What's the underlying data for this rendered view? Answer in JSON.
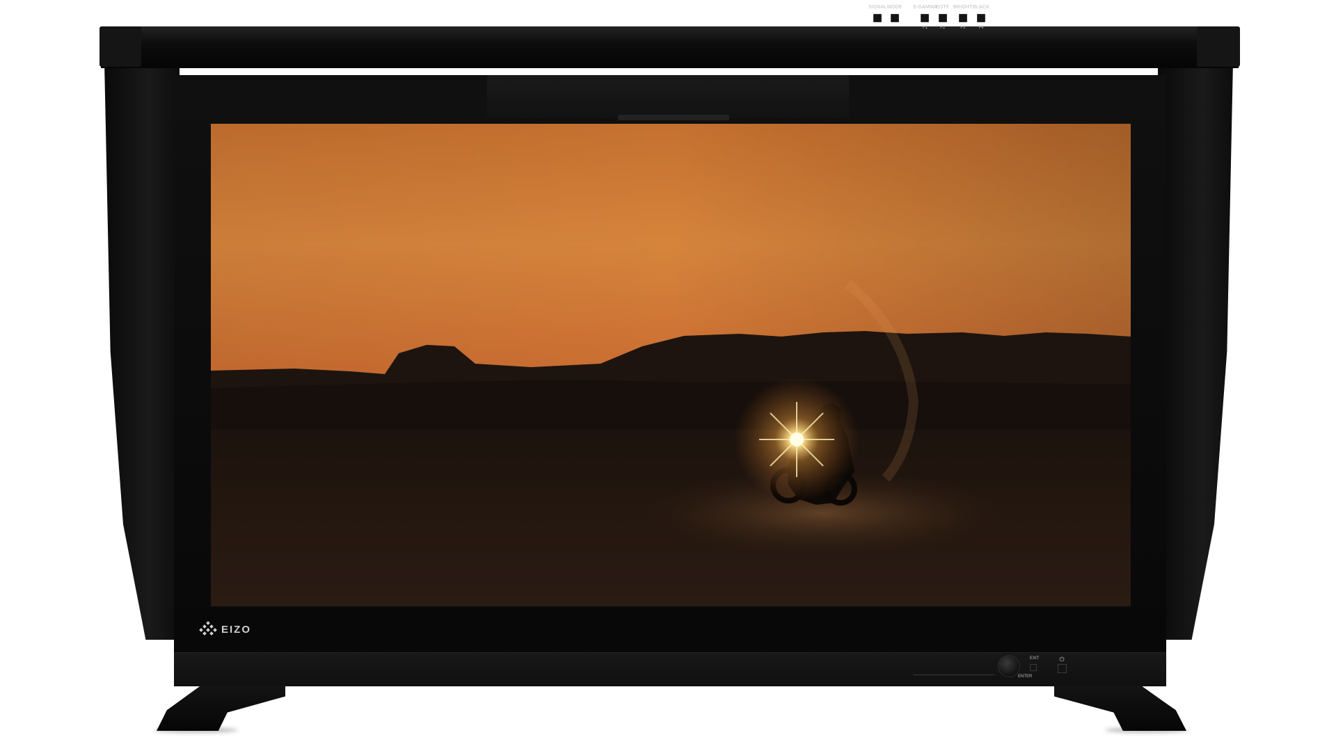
{
  "brand": {
    "logo_text": "EIZO",
    "logo_icon": "eizo-diamond-logo-icon"
  },
  "screen": {
    "scene": "desert-sunset-motorcycle",
    "colors": {
      "sky_top": "#c46a2e",
      "sky_bright": "#d9853e",
      "horizon": "#b0552a",
      "mountain": "#1a120e",
      "ground": "#140d09",
      "headlight": "#fff2c0"
    }
  },
  "controls": {
    "buttons": [
      {
        "label": "SIGNAL",
        "sub": ""
      },
      {
        "label": "MODE",
        "sub": ""
      },
      {
        "label": "S-GAMMA",
        "sub": "F1"
      },
      {
        "label": "EOTF",
        "sub": "F2"
      },
      {
        "label": "BRIGHT",
        "sub": "F3"
      },
      {
        "label": "BLACK",
        "sub": "F4"
      }
    ],
    "enter_label": "ENTER",
    "exit_label": "EXIT",
    "power_icon": "power-icon"
  }
}
